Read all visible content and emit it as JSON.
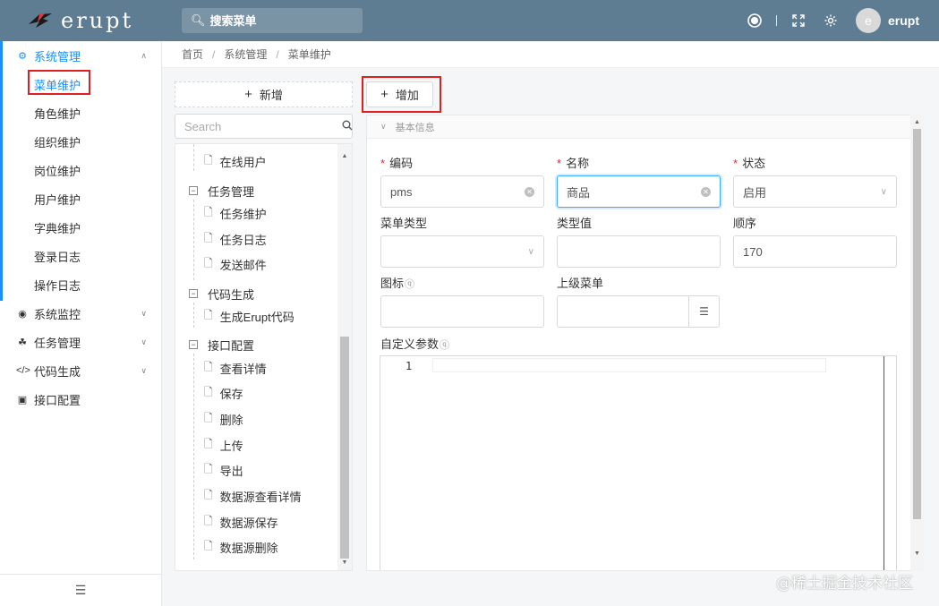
{
  "header": {
    "logo_text": "erupt",
    "search_placeholder": "搜索菜单",
    "user_initial": "e",
    "username": "erupt"
  },
  "sidebar": {
    "group_system": "系统管理",
    "items": [
      "菜单维护",
      "角色维护",
      "组织维护",
      "岗位维护",
      "用户维护",
      "字典维护",
      "登录日志",
      "操作日志"
    ],
    "group_monitor": "系统监控",
    "group_task": "任务管理",
    "group_codegen": "代码生成",
    "group_api": "接口配置"
  },
  "breadcrumb": [
    "首页",
    "系统管理",
    "菜单维护"
  ],
  "tree_panel": {
    "add_label": "新增",
    "search_placeholder": "Search",
    "nodes": {
      "online_users": "在线用户",
      "task_mgmt": "任务管理",
      "task_maint": "任务维护",
      "task_log": "任务日志",
      "send_mail": "发送邮件",
      "codegen": "代码生成",
      "gen_erupt": "生成Erupt代码",
      "api_config": "接口配置",
      "view_detail": "查看详情",
      "save": "保存",
      "delete": "删除",
      "upload": "上传",
      "export": "导出",
      "ds_view": "数据源查看详情",
      "ds_save": "数据源保存",
      "ds_delete": "数据源删除"
    }
  },
  "form": {
    "add_button": "增加",
    "section_title": "基本信息",
    "labels": {
      "code": "编码",
      "name": "名称",
      "status": "状态",
      "menu_type": "菜单类型",
      "type_value": "类型值",
      "order": "顺序",
      "icon": "图标",
      "parent": "上级菜单",
      "params": "自定义参数"
    },
    "values": {
      "code": "pms",
      "name": "商品",
      "status": "启用",
      "order": "170"
    },
    "editor_line": "1"
  },
  "watermark": "@稀土掘金技术社区",
  "colors": {
    "header_bg": "#5f7d92",
    "primary": "#1890ff",
    "highlight_box": "#e02020"
  }
}
